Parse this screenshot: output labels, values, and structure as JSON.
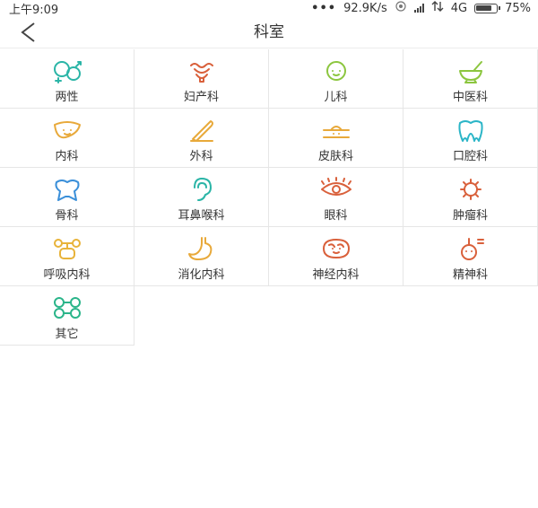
{
  "status_bar": {
    "time": "上午9:09",
    "speed": "92.9K/s",
    "network": "4G",
    "battery": "75%",
    "battery_level": 0.75
  },
  "header": {
    "title": "科室"
  },
  "departments": [
    {
      "label": "两性",
      "icon": "couple-icon",
      "color": "#2bb5a7"
    },
    {
      "label": "妇产科",
      "icon": "uterus-icon",
      "color": "#d9603b"
    },
    {
      "label": "儿科",
      "icon": "baby-face-icon",
      "color": "#8cc63f"
    },
    {
      "label": "中医科",
      "icon": "mortar-pestle-icon",
      "color": "#8cc63f"
    },
    {
      "label": "内科",
      "icon": "liver-icon",
      "color": "#e8a93a"
    },
    {
      "label": "外科",
      "icon": "scalpel-icon",
      "color": "#e8a93a"
    },
    {
      "label": "皮肤科",
      "icon": "skin-icon",
      "color": "#e8a93a"
    },
    {
      "label": "口腔科",
      "icon": "tooth-icon",
      "color": "#2bb5c7"
    },
    {
      "label": "骨科",
      "icon": "bone-icon",
      "color": "#3a8fd9"
    },
    {
      "label": "耳鼻喉科",
      "icon": "ear-icon",
      "color": "#2bb5a7"
    },
    {
      "label": "眼科",
      "icon": "eye-icon",
      "color": "#d9603b"
    },
    {
      "label": "肿瘤科",
      "icon": "tumor-cell-icon",
      "color": "#d9603b"
    },
    {
      "label": "呼吸内科",
      "icon": "lungs-icon",
      "color": "#e8b33a"
    },
    {
      "label": "消化内科",
      "icon": "stomach-icon",
      "color": "#e8a93a"
    },
    {
      "label": "神经内科",
      "icon": "brain-icon",
      "color": "#d9603b"
    },
    {
      "label": "精神科",
      "icon": "mental-health-icon",
      "color": "#d9603b"
    },
    {
      "label": "其它",
      "icon": "other-cells-icon",
      "color": "#2bb58a"
    }
  ]
}
